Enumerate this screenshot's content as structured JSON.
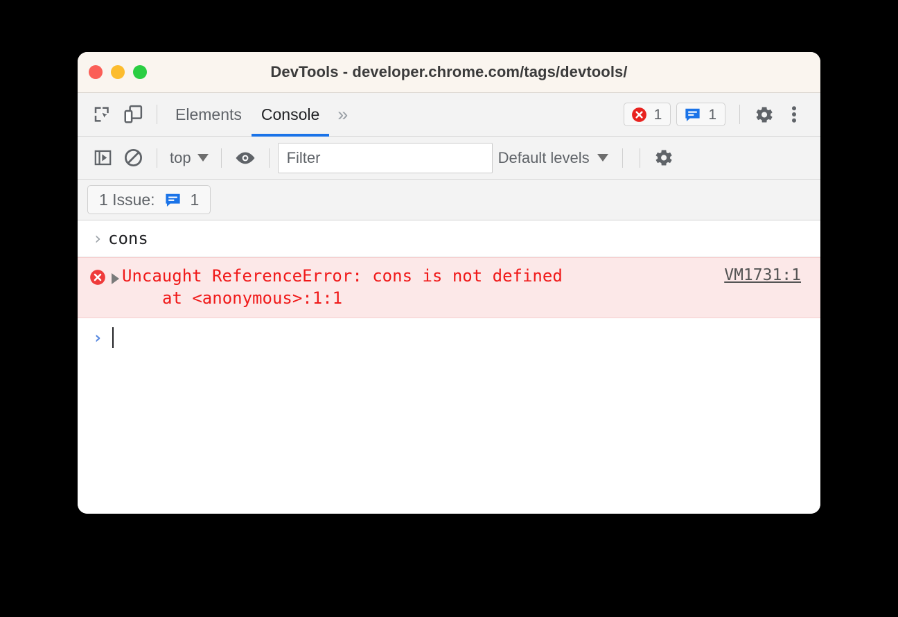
{
  "window": {
    "title": "DevTools - developer.chrome.com/tags/devtools/",
    "traffic_lights": [
      "close-red",
      "minimize-yellow",
      "zoom-green"
    ]
  },
  "tabbar": {
    "inspect_icon": "inspect-element-icon",
    "device_icon": "device-toolbar-icon",
    "tabs": [
      {
        "label": "Elements",
        "active": false
      },
      {
        "label": "Console",
        "active": true
      }
    ],
    "more_tabs_label": "»",
    "error_badge": {
      "icon": "error-circle-icon",
      "count": "1",
      "color": "#e8221f"
    },
    "issues_badge": {
      "icon": "issues-message-icon",
      "count": "1",
      "color": "#1a73e8"
    },
    "settings_icon": "gear-icon",
    "menu_icon": "kebab-menu-icon"
  },
  "filterbar": {
    "sidebar_icon": "console-sidebar-icon",
    "clear_icon": "clear-console-icon",
    "context_label": "top",
    "eye_icon": "live-expression-eye-icon",
    "filter": {
      "placeholder": "Filter",
      "value": ""
    },
    "levels_label": "Default levels",
    "settings_icon": "console-settings-gear-icon"
  },
  "issuebar": {
    "label": "1 Issue:",
    "icon": "issues-message-icon",
    "count": "1"
  },
  "console": {
    "entries": [
      {
        "type": "input",
        "prompt": "›",
        "text": "cons"
      },
      {
        "type": "error",
        "icon": "error-circle-icon",
        "disclosure": "collapsed-triangle-icon",
        "text": "Uncaught ReferenceError: cons is not defined",
        "stack": "at <anonymous>:1:1",
        "source": "VM1731:1",
        "color": "#f01919",
        "background": "#fce8e8"
      },
      {
        "type": "prompt",
        "prompt": "›",
        "text": ""
      }
    ]
  },
  "colors": {
    "accent_blue": "#1a73e8",
    "error_red": "#f01919",
    "titlebar_bg": "#faf5ef",
    "toolbar_bg": "#f3f3f3",
    "error_row_bg": "#fce8e8"
  }
}
